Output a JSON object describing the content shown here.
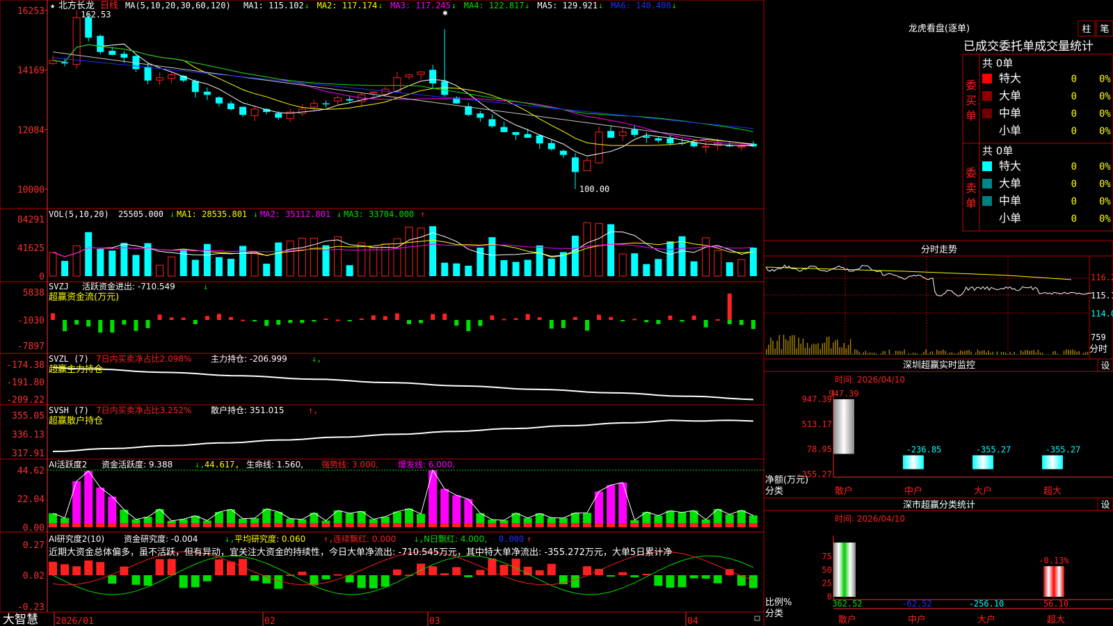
{
  "colors": {
    "up": "#ff2020",
    "down": "#00ffff",
    "grid": "#a00000",
    "axis": "#ff3030",
    "white": "#ffffff",
    "yellow": "#ffff00",
    "magenta": "#ff00ff",
    "green": "#00e000",
    "blue": "#2030ff",
    "gray": "#c8c8c8",
    "olive": "#a08000"
  },
  "kline": {
    "stock_name": "北方长龙",
    "period": "日线",
    "ma_label": "MA(5,10,20,30,60,120)",
    "ma": [
      {
        "label": "MA1: 115.102",
        "arrow": "↓"
      },
      {
        "label": "MA2: 117.174",
        "arrow": "↓"
      },
      {
        "label": "MA3: 117.245",
        "arrow": "↓"
      },
      {
        "label": "MA4: 122.817",
        "arrow": "↓"
      },
      {
        "label": "MA5: 129.921",
        "arrow": "↓"
      },
      {
        "label": "MA6: 140.408",
        "arrow": "↓"
      }
    ],
    "yticks": [
      "16253",
      "14169",
      "12084",
      "10000"
    ],
    "high_mark": "162.53",
    "low_mark": "100.00"
  },
  "vol": {
    "title": "VOL(5,10,20)",
    "value": "25505.000",
    "ma1": "MA1: 28535.801",
    "ma2": "MA2: 35112.801",
    "ma3": "MA3: 33704.000",
    "arrow_down": "↓",
    "arrow_up": "↑",
    "yticks": [
      "84291",
      "41625",
      "0"
    ]
  },
  "svzj": {
    "title": "SVZJ",
    "label": "活跃资金进出: -710.549",
    "arrow": "↓",
    "subtitle": "超赢资金流(万元)",
    "yticks": [
      "5838",
      "-1030",
      "-7897"
    ]
  },
  "svzl": {
    "title": "SVZL (7)",
    "ratio": "7日内买卖净占比2.098%",
    "label": "主力持仓: -206.999",
    "arrow": "↓,",
    "subtitle": "超赢主力持仓",
    "yticks": [
      "-174.38",
      "-191.80",
      "-209.22"
    ]
  },
  "svsh": {
    "title": "SVSH (7)",
    "ratio": "7日内买卖净占比3.252%",
    "label": "散户持仓: 351.015",
    "arrow": "↑,",
    "subtitle": "超赢散户持仓",
    "yticks": [
      "355.05",
      "336.13",
      "317.91"
    ]
  },
  "ai_active": {
    "title": "AI活跃度2",
    "l1": "资金活跃度: 9.388",
    "a1": "↓,",
    "l2": "44.617,",
    "l3": "生命线: 1.560,",
    "l4": "强势线: 3.000,",
    "l5": "爆发线: 6.000,",
    "yticks": [
      "44.62",
      "22.04",
      "0.00"
    ]
  },
  "ai_research": {
    "title": "AI研究度2(10)",
    "l1": "资金研究度: -0.004",
    "a1": "↓,",
    "l2": "平均研究度: 0.060",
    "a2": "↑,",
    "l3": "连续飘红: 0.000",
    "a3": "↓,",
    "l4": "N日飘红: 4.000,",
    "l5": "0.000",
    "a5": "↑",
    "comment": "近期大资金总体偏多，虽不活跃，但有异动，宜关注大资金的持续性，今日大单净流出: -710.545万元，其中特大单净流出: -355.272万元，大单5日累计净",
    "yticks": [
      "0.27",
      "0.02",
      "-0.23"
    ]
  },
  "xaxis": {
    "labels": [
      "2026/01",
      "02",
      "03",
      "04"
    ],
    "brand": "大智慧"
  },
  "right": {
    "lhb": {
      "title": "龙虎看盘(逐单)",
      "btn1": "柱",
      "btn2": "笔",
      "subtitle": "已成交委托单成交量统计",
      "buy_label": "委买单",
      "sell_label": "委卖单",
      "buy_total": "共 0单",
      "sell_total": "共 0单",
      "buy_rows": [
        {
          "name": "特大",
          "count": "0",
          "pct": "0%"
        },
        {
          "name": "大单",
          "count": "0",
          "pct": "0%"
        },
        {
          "name": "中单",
          "count": "0",
          "pct": "0%"
        },
        {
          "name": "小单",
          "count": "0",
          "pct": "0%"
        }
      ],
      "sell_rows": [
        {
          "name": "特大",
          "count": "0",
          "pct": "0%"
        },
        {
          "name": "大单",
          "count": "0",
          "pct": "0%"
        },
        {
          "name": "中单",
          "count": "0",
          "pct": "0%"
        },
        {
          "name": "小单",
          "count": "0",
          "pct": "0%"
        }
      ]
    },
    "fenshi": {
      "title": "分时走势",
      "p1": "116.2",
      "p2": "115.1",
      "p3": "114.0",
      "vol": "759",
      "unit": "分时"
    },
    "sz_monitor": {
      "title": "深圳超赢实时监控",
      "btn": "设",
      "time": "时间: 2026/04/10",
      "yticks": [
        "947.39",
        "513.17",
        "78.95",
        "-355.27"
      ],
      "ylabel": "净额(万元)",
      "xlabel": "分类",
      "cats": [
        "散户",
        "中户",
        "大户",
        "超大"
      ],
      "values": [
        947.39,
        -236.85,
        -355.27,
        -355.27
      ],
      "value_labels": [
        "947.39",
        "-236.85",
        "-355.27",
        "-355.27"
      ]
    },
    "sh_stats": {
      "title": "深市超赢分类统计",
      "btn": "设",
      "time": "时间: 2026/04/10",
      "yticks": [
        "75",
        "50",
        "25",
        "0"
      ],
      "ylabel": "比例%",
      "xlabel": "分类",
      "cats": [
        "散户",
        "中户",
        "大户",
        "超大"
      ],
      "pcts": [
        99.5,
        0,
        0,
        -0.13
      ],
      "top_label": "-0.13%",
      "value_labels": [
        "362.52",
        "-62.52",
        "-256.10",
        "56.10"
      ]
    }
  }
}
